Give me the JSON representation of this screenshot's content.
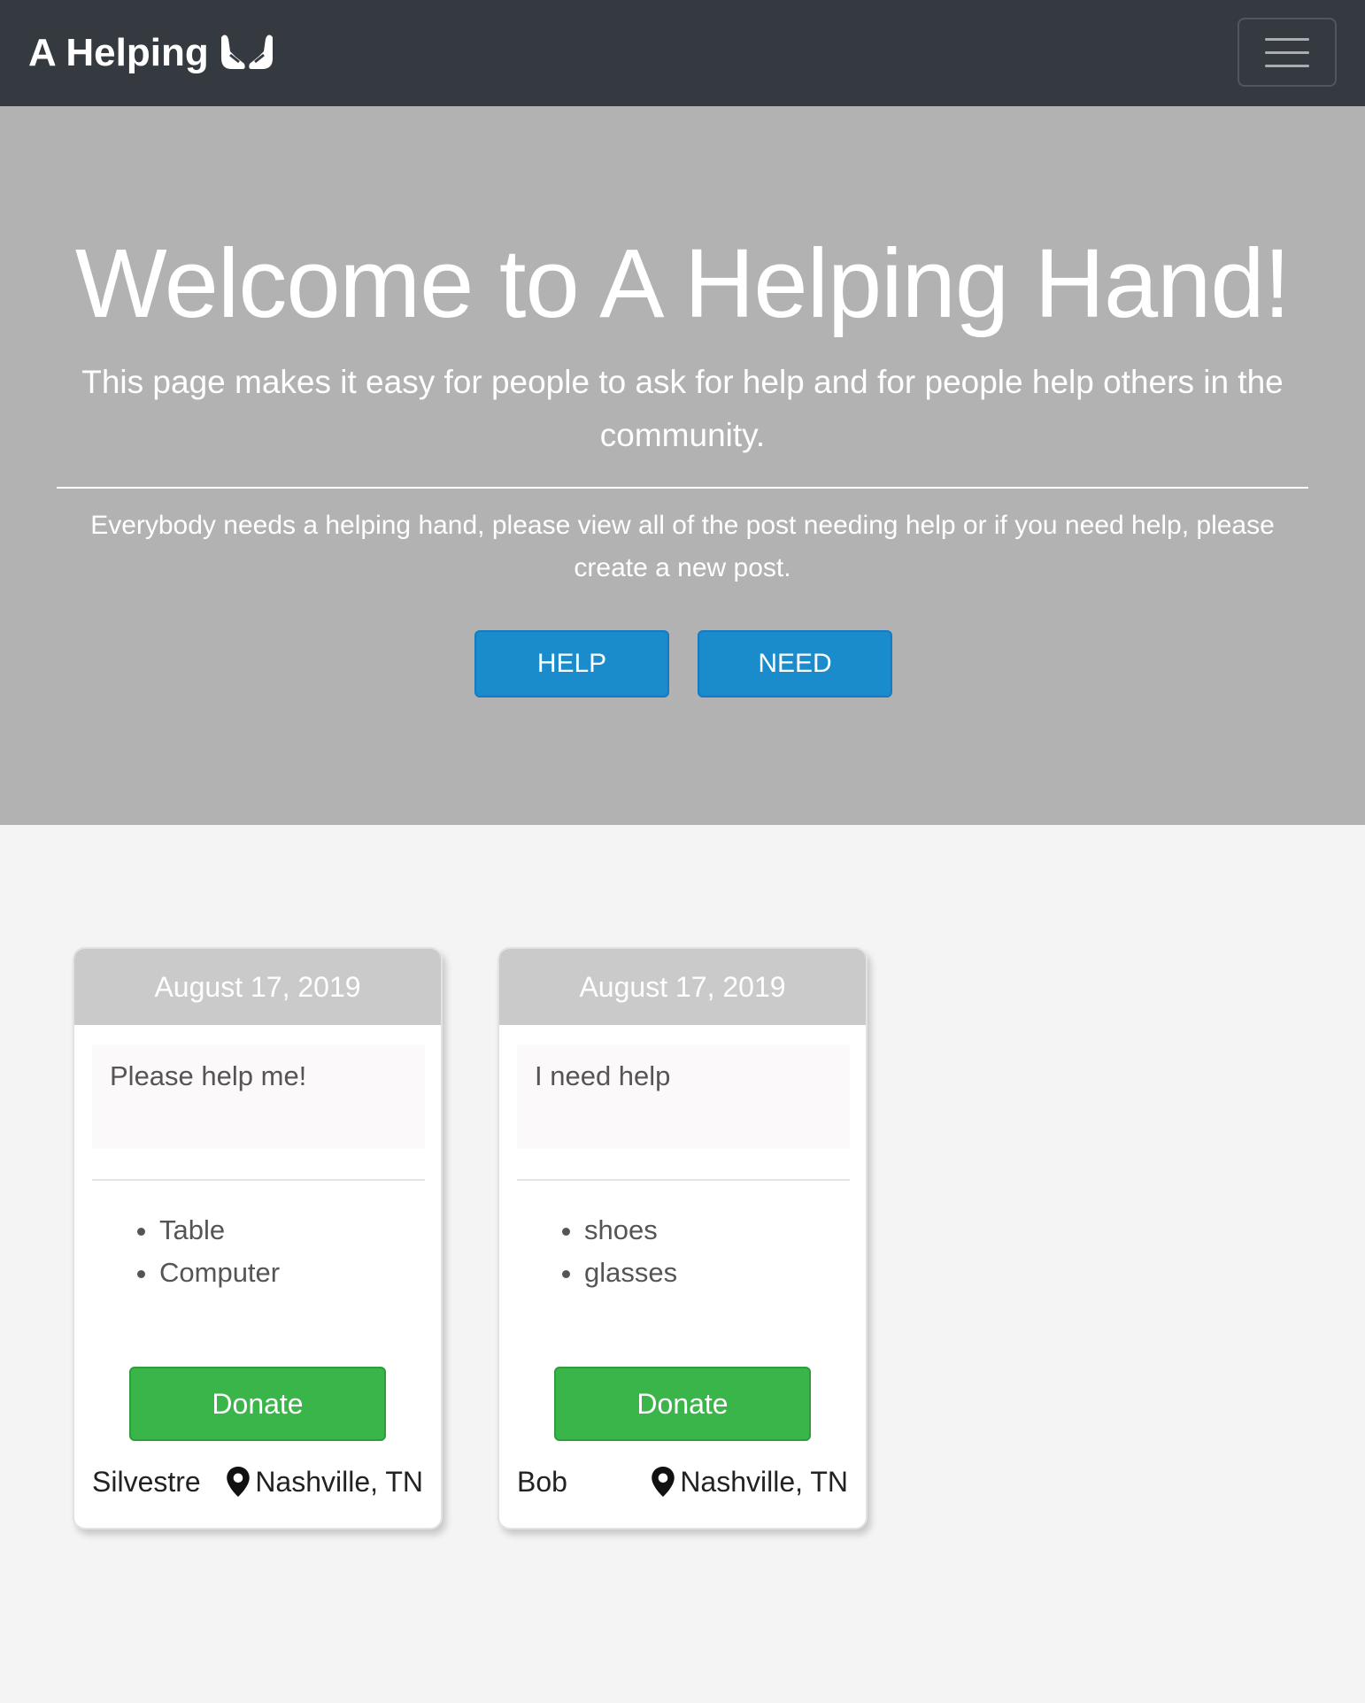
{
  "navbar": {
    "brand": "A Helping",
    "brand_icon": "helping-hands-icon",
    "menu_icon": "hamburger-menu-icon"
  },
  "hero": {
    "title": "Welcome to A Helping Hand!",
    "lead": "This page makes it easy for people to ask for help and for people help others in the community.",
    "text": "Everybody needs a helping hand, please view all of the post needing help or if you need help, please create a new post.",
    "help_button": "HELP",
    "need_button": "NEED"
  },
  "posts": [
    {
      "date": "August 17, 2019",
      "message": "Please help me!",
      "items": [
        "Table",
        "Computer"
      ],
      "donate_label": "Donate",
      "name": "Silvestre",
      "location": "Nashville, TN"
    },
    {
      "date": "August 17, 2019",
      "message": "I need help",
      "items": [
        "shoes",
        "glasses"
      ],
      "donate_label": "Donate",
      "name": "Bob",
      "location": "Nashville, TN"
    }
  ],
  "colors": {
    "navbar": "#343a40",
    "hero": "#b2b2b2",
    "primary_button": "#1a8ccc",
    "donate_button": "#3ab54a",
    "card_header": "#cacaca"
  }
}
